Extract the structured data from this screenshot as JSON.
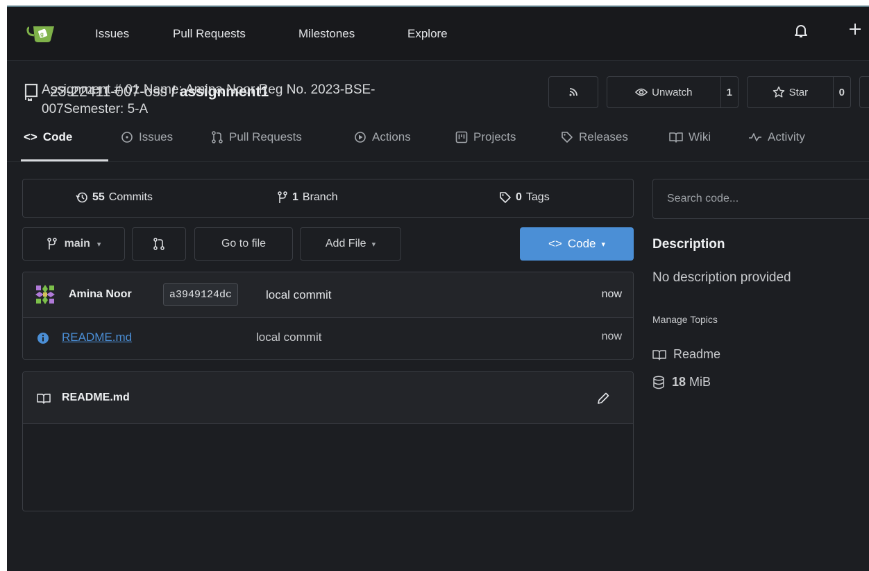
{
  "topbar": {
    "nav": [
      "Issues",
      "Pull Requests",
      "Milestones",
      "Explore"
    ],
    "icons": [
      "bell-icon",
      "plus-icon"
    ]
  },
  "repo": {
    "owner": "23-22411-007-oss",
    "separator": "/",
    "name": "assignment1",
    "watch_label": "Unwatch",
    "watch_count": "1",
    "star_label": "Star",
    "star_count": "0"
  },
  "tabs": [
    {
      "label": "Code",
      "icon": "code-icon",
      "active": true
    },
    {
      "label": "Issues",
      "icon": "issue-icon"
    },
    {
      "label": "Pull Requests",
      "icon": "pull-request-icon"
    },
    {
      "label": "Actions",
      "icon": "play-icon"
    },
    {
      "label": "Projects",
      "icon": "project-icon"
    },
    {
      "label": "Releases",
      "icon": "tag-icon"
    },
    {
      "label": "Wiki",
      "icon": "book-icon"
    },
    {
      "label": "Activity",
      "icon": "pulse-icon"
    }
  ],
  "stats": {
    "commits_count": "55",
    "commits_label": "Commits",
    "branch_count": "1",
    "branch_label": "Branch",
    "tags_count": "0",
    "tags_label": "Tags"
  },
  "search": {
    "placeholder": "Search code..."
  },
  "toolbar": {
    "branch": "main",
    "goto_file": "Go to file",
    "add_file": "Add File",
    "code": "Code"
  },
  "latest_commit": {
    "author": "Amina Noor",
    "sha": "a3949124dc",
    "message": "local commit",
    "time": "now"
  },
  "files": [
    {
      "name": "README.md",
      "message": "local commit",
      "time": "now",
      "icon": "info-icon"
    }
  ],
  "readme": {
    "title": "README.md",
    "content_line1": "Assignment # 01 Name: Amina Noor Reg No. 2023-BSE-",
    "content_line2": "007Semester: 5-A"
  },
  "sidebar": {
    "description_heading": "Description",
    "description": "No description provided",
    "manage_topics": "Manage Topics",
    "readme_link": "Readme",
    "size_value": "18",
    "size_unit": "MiB"
  },
  "colors": {
    "background": "#1c1e22",
    "topbar": "#18191c",
    "accent": "#4b8fd6",
    "link": "#4b8fd6",
    "border": "#3a3d43"
  }
}
